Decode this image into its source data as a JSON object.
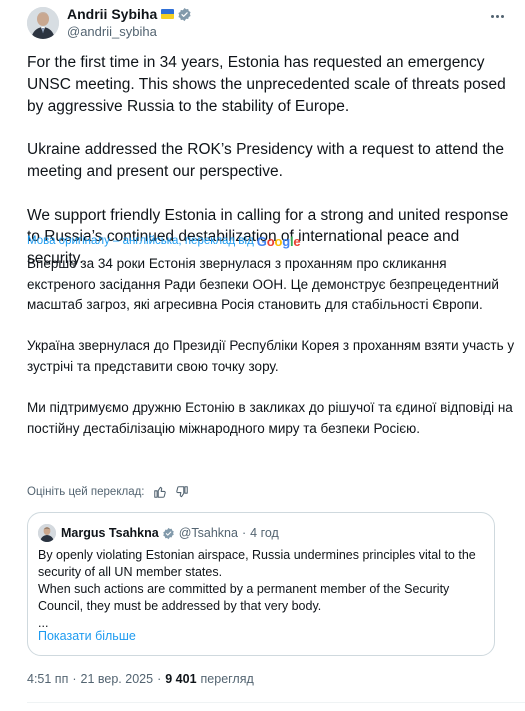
{
  "author": {
    "display_name": "Andrii Sybiha",
    "handle": "@andrii_sybiha",
    "flag": "ukraine-flag",
    "verified": true
  },
  "post": {
    "text_en": "For the first time in 34 years, Estonia has requested an emergency UNSC meeting. This shows the unprecedented scale of threats posed by aggressive Russia to the stability of Europe.\n\nUkraine addressed the ROK’s Presidency with a request to attend the meeting and present our perspective.\n\nWe support friendly Estonia in calling for a strong and united response to Russia’s continued destabilization of international peace and security.",
    "translation_note": "Мова оригіналу – англійська, переклад від",
    "translation_provider": "Google",
    "text_uk": "Вперше за 34 роки Естонія звернулася з проханням про скликання екстреного засідання Ради безпеки ООН. Це демонструє безпрецедентний масштаб загроз, які агресивна Росія становить для стабільності Європи.\n\nУкраїна звернулася до Президії Республіки Корея з проханням взяти участь у зустрічі та представити свою точку зору.\n\nМи підтримуємо дружню Естонію в закликах до рішучої та єдиної відповіді на постійну дестабілізацію міжнародного миру та безпеки Росією.",
    "rate_translation_label": "Оцініть цей переклад:"
  },
  "quote": {
    "display_name": "Margus Tsahkna",
    "handle": "@Tsahkna",
    "separator": "·",
    "time": "4 год",
    "text": "By openly violating Estonian airspace, Russia undermines principles vital to the security of all UN member states.\nWhen such actions are committed by a permanent member of the Security Council, they must be addressed by that very body.\n...",
    "show_more": "Показати більше"
  },
  "meta": {
    "time": "4:51 пп",
    "separator": "·",
    "date": "21 вер. 2025",
    "views_count": "9 401",
    "views_label": "перегляд"
  },
  "colors": {
    "text": "#0f1419",
    "secondary": "#536471",
    "link": "#1d9bf0",
    "border": "#cfd9de"
  }
}
